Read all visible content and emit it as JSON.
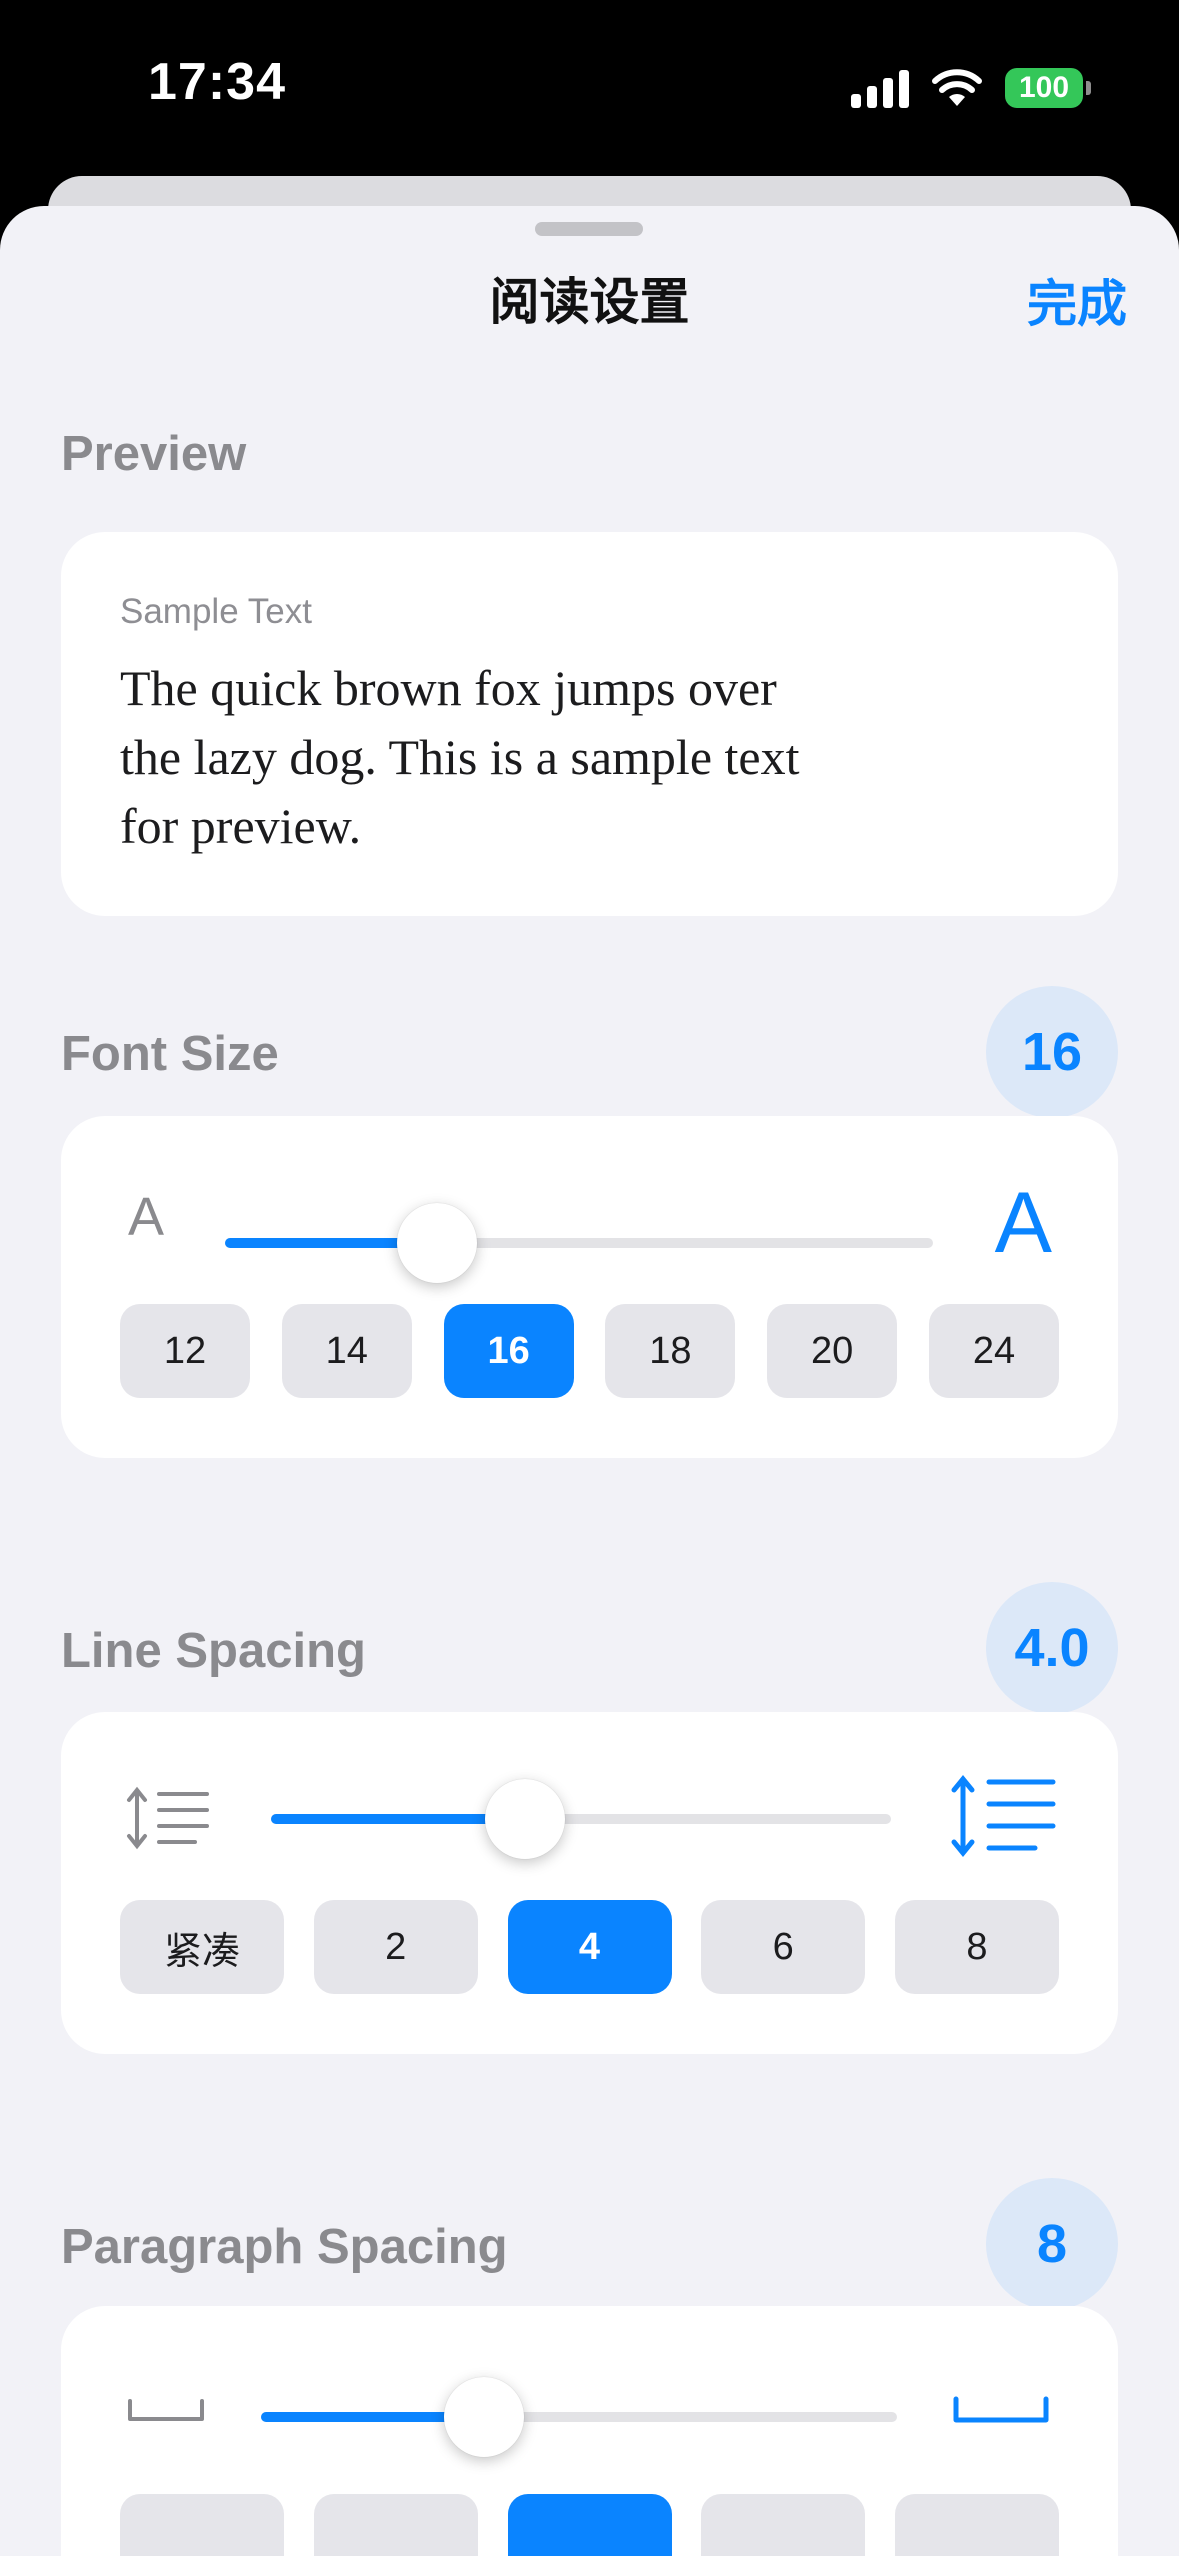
{
  "status": {
    "time": "17:34",
    "battery": "100"
  },
  "nav": {
    "title": "阅读设置",
    "done": "完成"
  },
  "preview": {
    "title": "Preview",
    "sample_label": "Sample Text",
    "sample_text": "The quick brown fox jumps over the lazy dog. This is a sample text for preview."
  },
  "font_size": {
    "title": "Font Size",
    "value": "16",
    "small_glyph": "A",
    "large_glyph": "A",
    "slider_fraction": 0.3,
    "options": [
      "12",
      "14",
      "16",
      "18",
      "20",
      "24"
    ],
    "selected_index": 2
  },
  "line_spacing": {
    "title": "Line Spacing",
    "value": "4.0",
    "slider_fraction": 0.41,
    "options": [
      "紧凑",
      "2",
      "4",
      "6",
      "8"
    ],
    "selected_index": 2
  },
  "paragraph_spacing": {
    "title": "Paragraph Spacing",
    "value": "8",
    "slider_fraction": 0.35
  },
  "colors": {
    "accent": "#0A84FF",
    "background": "#F2F2F7",
    "badge_bg": "#DCE8F8"
  },
  "icons": [
    "signal-icon",
    "wifi-icon",
    "battery-icon",
    "line-spacing-compact-icon",
    "line-spacing-wide-icon",
    "paragraph-spacing-small-icon",
    "paragraph-spacing-large-icon"
  ]
}
